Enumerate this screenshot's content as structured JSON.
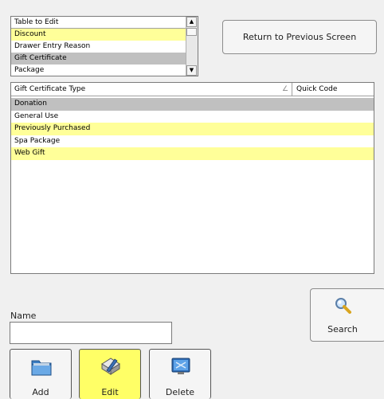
{
  "table_list": {
    "header": "Table to Edit",
    "items": [
      {
        "label": "Discount",
        "style": "yellow"
      },
      {
        "label": "Drawer Entry Reason",
        "style": "white"
      },
      {
        "label": "Gift Certificate",
        "style": "gray"
      },
      {
        "label": "Package",
        "style": "white"
      }
    ]
  },
  "return_button": {
    "label": "Return to Previous Screen"
  },
  "grid": {
    "columns": [
      "Gift Certificate Type",
      "Quick Code"
    ],
    "rows": [
      {
        "type": "Donation",
        "quick_code": "",
        "style": "gray"
      },
      {
        "type": "General Use",
        "quick_code": "",
        "style": "white"
      },
      {
        "type": "Previously Purchased",
        "quick_code": "",
        "style": "yellow"
      },
      {
        "type": "Spa Package",
        "quick_code": "",
        "style": "white"
      },
      {
        "type": "Web Gift",
        "quick_code": "",
        "style": "yellow"
      }
    ]
  },
  "search_button": {
    "label": "Search",
    "icon": "magnifier-icon"
  },
  "name_field": {
    "label": "Name",
    "value": ""
  },
  "actions": {
    "add_label": "Add",
    "edit_label": "Edit",
    "delete_label": "Delete"
  },
  "colors": {
    "highlight_yellow": "#ffff99",
    "selected_gray": "#c0c0c0",
    "active_button": "#ffff66"
  }
}
